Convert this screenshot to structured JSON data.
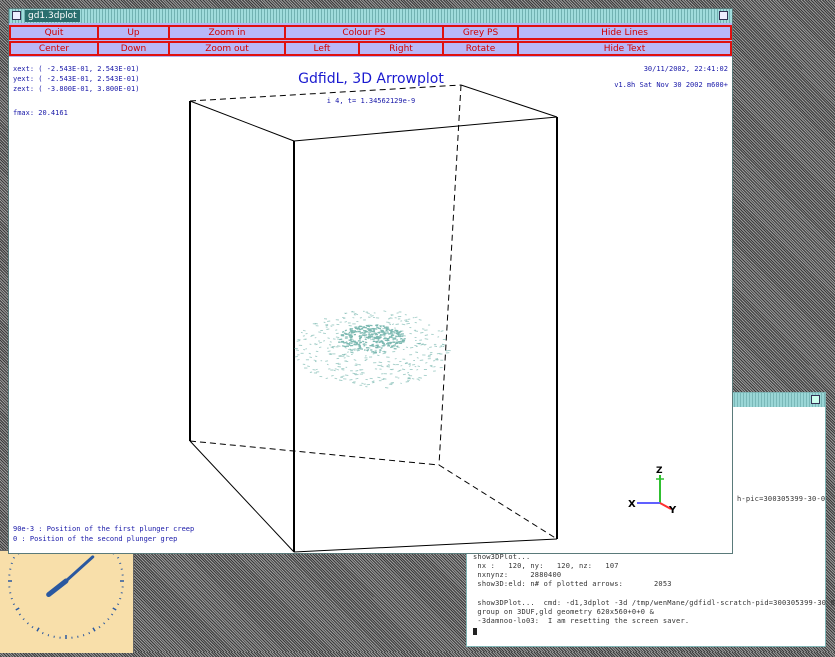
{
  "window": {
    "title": "gd1.3dplot",
    "menu_row1": [
      "Quit",
      "Up",
      "Zoom in",
      "Colour PS",
      "Grey PS",
      "Hide Lines"
    ],
    "menu_row2": [
      "Center",
      "Down",
      "Zoom out",
      "Left",
      "Right",
      "Rotate",
      "Hide Text"
    ]
  },
  "plot": {
    "title": "GdfidL, 3D Arrowplot",
    "subtitle": "i 4, t= 1.34562129e-9",
    "date": "30/11/2002, 22:41:02",
    "version": "v1.8h Sat Nov 30 2002 m600+",
    "xext": "xext: ( -2.543E-01,  2.543E-01)",
    "yext": "yext: ( -2.543E-01,  2.543E-01)",
    "zext": "zext: ( -3.800E-01,  3.800E-01)",
    "fmax": "fmax:   20.4161",
    "note1": "90e-3 : Position of the first plunger  creep",
    "note2": "0 : Position of the second plunger grep",
    "axis_labels": {
      "z": "Z",
      "x": "X",
      "y": "Y"
    },
    "colors": {
      "arrows": "#7ab8b0",
      "box": "#000000",
      "text": "#1818a8"
    }
  },
  "terminal": {
    "lines_top": [
      "h-pic=300305399-30-0"
    ],
    "lines_bottom": [
      "show3DPlot...",
      " nx :   120, ny:   120, nz:   107",
      " nxnynz:     2880400",
      " show3D:eld: n# of plotted arrows:       2053",
      "",
      " show3DPlot...  cmd: -d1,3dplot -3d /tmp/wenMane/gdfidl-scratch-pid=300305399-30-0",
      " group on 3DUF,gld geometry 620x560+0+0 &",
      " -3damnoo-lo03:  I am resetting the screen saver."
    ]
  },
  "clock": {
    "hour_angle": 232,
    "minute_angle": 48
  }
}
